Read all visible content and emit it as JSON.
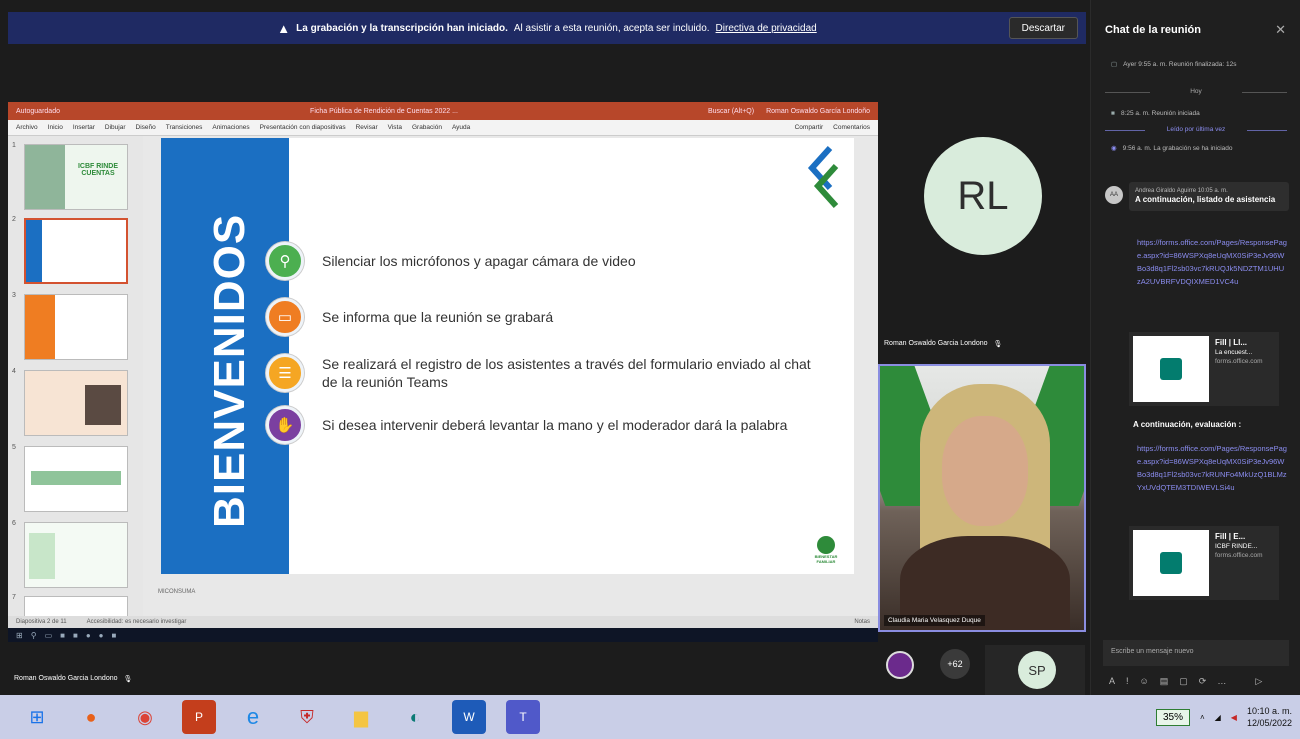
{
  "banner": {
    "bold_text": "La grabación y la transcripción han iniciado.",
    "text": "Al asistir a esta reunión, acepta ser incluido.",
    "link": "Directiva de privacidad",
    "dismiss": "Descartar"
  },
  "ppt": {
    "title_left": "Autoguardado",
    "title_center": "Ficha Pública de Rendición de Cuentas 2022 ...",
    "title_search": "Buscar (Alt+Q)",
    "title_user": "Roman Oswaldo García Londoño",
    "menu": [
      "Archivo",
      "Inicio",
      "Insertar",
      "Dibujar",
      "Diseño",
      "Transiciones",
      "Animaciones",
      "Presentación con diapositivas",
      "Revisar",
      "Vista",
      "Grabación",
      "Ayuda"
    ],
    "share_label": "Compartir",
    "comments_label": "Comentarios",
    "slide_count": "Diapositiva 2 de 11",
    "notes_hint": "Notas",
    "accessibility": "Accesibilidad: es necesario investigar",
    "thumb_title": "ICBF RINDE CUENTAS",
    "footer_hint": "MICONSUMA"
  },
  "slide": {
    "band_text": "BIENVENIDOS",
    "bullets": [
      {
        "text": "Silenciar  los micrófonos y  apagar cámara de video",
        "icon": "search-icon",
        "color": "#4caf50"
      },
      {
        "text": "Se informa que la reunión se grabará",
        "icon": "presentation-icon",
        "color": "#ef7d22"
      },
      {
        "text": "Se realizará el registro de los asistentes a través del formulario enviado al chat",
        "text2": "de la reunión Teams",
        "icon": "form-icon",
        "color": "#f5a623"
      },
      {
        "text": "Si desea intervenir deberá levantar la mano y el moderador dará la palabra",
        "icon": "hand-icon",
        "color": "#7b3fa0"
      }
    ],
    "brand_text": "BIENESTAR FAMILIAR"
  },
  "participants": {
    "rl_initials": "RL",
    "rl_name": "Roman Oswaldo Garcia Londono",
    "video_name": "Claudia Maria Velasquez Duque",
    "bottom_name": "Roman Oswaldo Garcia Londono",
    "more_count": "+62",
    "sp_initials": "SP"
  },
  "chat": {
    "title": "Chat de la reunión",
    "sys1": "Ayer 9:55 a. m.  Reunión finalizada: 12s",
    "today": "Hoy",
    "sys2": "8:25 a. m.  Reunión iniciada",
    "last_read": "Leído por última vez",
    "sys3": "9:56 a. m.  La grabación se ha iniciado",
    "msg_initials": "AA",
    "msg_author": "Andrea Giraldo Aguirre",
    "msg_time": "10:05 a. m.",
    "msg_text": "A continuación, listado de asistencia",
    "link1": "https://forms.office.com/Pages/ResponsePage.aspx?id=86WSPXq8eUqMX0SiP3eJv96WBo3d8q1Fl2sb03vc7kRUQJk5NDZTM1UHUzA2UVBRFVDQIXMED1VC4u",
    "card1_title": "Fill | Ll...",
    "card1_sub": "La encuest...",
    "card1_domain": "forms.office.com",
    "label2": "A continuación, evaluación :",
    "link2": "https://forms.office.com/Pages/ResponsePage.aspx?id=86WSPXq8eUqMX0SiP3eJv96WBo3d8q1Fl2sb03vc7kRUNFo4MkUzQ1BLMzYxUVdQTEM3TDIWEVLSi4u",
    "card2_title": "Fill | E...",
    "card2_sub": "ICBF RINDE...",
    "card2_domain": "forms.office.com",
    "compose_placeholder": "Escribe un mensaje nuevo"
  },
  "taskbar": {
    "battery": "35%",
    "time": "10:10 a. m.",
    "date": "12/05/2022"
  }
}
